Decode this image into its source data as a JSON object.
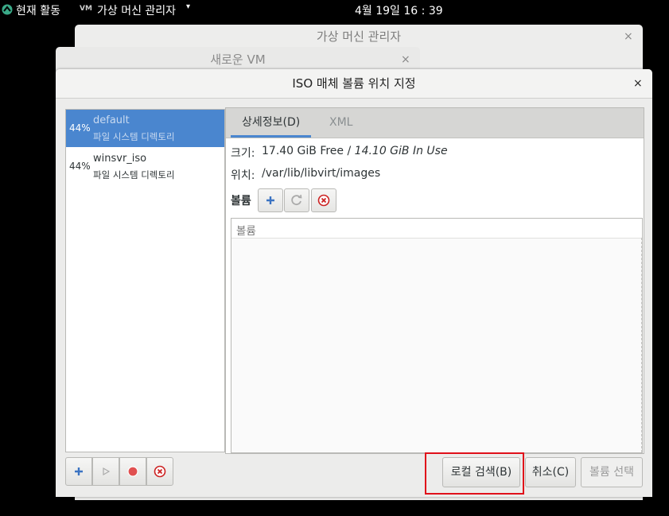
{
  "topbar": {
    "activities": "현재 활동",
    "app_icon": "VM",
    "app_menu": "가상 머신 관리자",
    "app_arrow": "▾",
    "clock": "4월 19일  16 : 39"
  },
  "bg_windows": {
    "main_title": "가상 머신 관리자",
    "newvm_title": "새로운 VM",
    "close_glyph": "×"
  },
  "dialog": {
    "title": "ISO 매체 볼륨 위치 지정",
    "close_glyph": "×",
    "pools": [
      {
        "pct": "44%",
        "name": "default",
        "type": "파일 시스템 디렉토리",
        "selected": true
      },
      {
        "pct": "44%",
        "name": "winsvr_iso",
        "type": "파일 시스템 디렉토리",
        "selected": false
      }
    ],
    "tabs": [
      {
        "label": "상세정보(D)",
        "active": true
      },
      {
        "label": "XML",
        "active": false
      }
    ],
    "details": {
      "size_label": "크기:",
      "size_free": "17.40 GiB Free / ",
      "size_inuse": "14.10 GiB In Use",
      "location_label": "위치:",
      "location_value": "/var/lib/libvirt/images",
      "volumes_label": "볼륨",
      "volumes_column": "볼륨"
    },
    "buttons": {
      "browse_local": "로컬 검색(B)",
      "cancel": "취소(C)",
      "choose_volume": "볼륨 선택"
    },
    "colors": {
      "selection": "#4a86cf",
      "highlight_box": "#e0101a",
      "add_icon": "#3b73c2",
      "stop_icon": "#cc2222"
    }
  }
}
